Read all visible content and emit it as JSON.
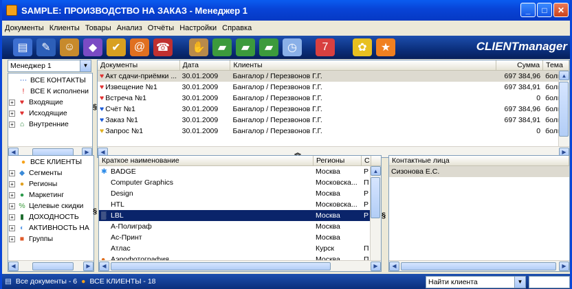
{
  "window": {
    "title": "SAMPLE: ПРОИЗВОДСТВО НА ЗАКАЗ - Менеджер 1"
  },
  "menu": [
    "Документы",
    "Клиенты",
    "Товары",
    "Анализ",
    "Отчёты",
    "Настройки",
    "Справка"
  ],
  "toolbar": {
    "icons": [
      "book-icon",
      "pen-icon",
      "user-icon",
      "shapes-icon",
      "check-icon",
      "email-icon",
      "phone-icon",
      "handshake-icon",
      "car-icon",
      "car-icon",
      "car-icon",
      "clock-icon",
      "calendar-icon",
      "flower-icon",
      "star-icon"
    ],
    "brand": "CLIENTmanager"
  },
  "manager_select": {
    "value": "Менеджер 1"
  },
  "doc_tree": [
    {
      "label": "ВСЕ КОНТАКТЫ",
      "icon": "contacts-icon",
      "expand": ""
    },
    {
      "label": "ВСЕ К исполнени",
      "icon": "exclamation-icon",
      "expand": ""
    },
    {
      "label": "Входящие",
      "icon": "heart-icon",
      "expand": "+"
    },
    {
      "label": "Исходящие",
      "icon": "heart-icon",
      "expand": "+"
    },
    {
      "label": "Внутренние",
      "icon": "house-icon",
      "expand": "+"
    }
  ],
  "doc_table": {
    "columns": [
      "Документы",
      "Дата",
      "Клиенты",
      "Сумма",
      "Тема"
    ],
    "rows": [
      {
        "doc": "Акт сдачи-приёмки ...",
        "date": "30.01.2009",
        "client": "Бангалор / Перезвонов Г.Г.",
        "sum": "697 384,96",
        "topic": "больш"
      },
      {
        "doc": "Извещение №1",
        "date": "30.01.2009",
        "client": "Бангалор / Перезвонов Г.Г.",
        "sum": "697 384,91",
        "topic": "больш"
      },
      {
        "doc": "Встреча №1",
        "date": "30.01.2009",
        "client": "Бангалор / Перезвонов Г.Г.",
        "sum": "0",
        "topic": "больш"
      },
      {
        "doc": "Счёт №1",
        "date": "30.01.2009",
        "client": "Бангалор / Перезвонов Г.Г.",
        "sum": "697 384,96",
        "topic": "больш"
      },
      {
        "doc": "Заказ №1",
        "date": "30.01.2009",
        "client": "Бангалор / Перезвонов Г.Г.",
        "sum": "697 384,91",
        "topic": "больш"
      },
      {
        "doc": "Запрос №1",
        "date": "30.01.2009",
        "client": "Бангалор / Перезвонов Г.Г.",
        "sum": "0",
        "topic": "больш"
      }
    ]
  },
  "client_tree": [
    {
      "label": "ВСЕ КЛИЕНТЫ",
      "icon": "clients-icon",
      "expand": ""
    },
    {
      "label": "Сегменты",
      "icon": "segments-icon",
      "expand": "+"
    },
    {
      "label": "Регионы",
      "icon": "regions-icon",
      "expand": "+"
    },
    {
      "label": "Маркетинг",
      "icon": "marketing-icon",
      "expand": "+"
    },
    {
      "label": "Целевые скидки",
      "icon": "discount-icon",
      "expand": "+"
    },
    {
      "label": "ДОХОДНОСТЬ",
      "icon": "chart-icon",
      "expand": "+"
    },
    {
      "label": "АКТИВНОСТЬ НА",
      "icon": "activity-icon",
      "expand": "+"
    },
    {
      "label": "Группы",
      "icon": "groups-icon",
      "expand": "+"
    }
  ],
  "client_table": {
    "columns": [
      "Краткое наименование",
      "Регионы",
      "С"
    ],
    "rows": [
      {
        "name": "BADGE",
        "region": "Москва",
        "c": "Р",
        "icon": "star"
      },
      {
        "name": "Computer Graphics",
        "region": "Московска...",
        "c": "П",
        "icon": ""
      },
      {
        "name": "Design",
        "region": "Москва",
        "c": "Р",
        "icon": ""
      },
      {
        "name": "HTL",
        "region": "Московска...",
        "c": "Р",
        "icon": ""
      },
      {
        "name": "LBL",
        "region": "Москва",
        "c": "Р",
        "icon": ""
      },
      {
        "name": "А-Полиграф",
        "region": "Москва",
        "c": "",
        "icon": ""
      },
      {
        "name": "Ас-Принт",
        "region": "Москва",
        "c": "",
        "icon": ""
      },
      {
        "name": "Атлас",
        "region": "Курск",
        "c": "П",
        "icon": ""
      },
      {
        "name": "Аэрофотография",
        "region": "Москва",
        "c": "П",
        "icon": "circle"
      }
    ],
    "selected_index": 4
  },
  "contacts_table": {
    "columns": [
      "Контактные лица"
    ],
    "rows": [
      "Сизонова Е.С."
    ]
  },
  "status": {
    "docs": "Все документы - 6",
    "clients": "ВСЕ КЛИЕНТЫ - 18"
  },
  "find_client": {
    "value": "Найти клиента"
  }
}
